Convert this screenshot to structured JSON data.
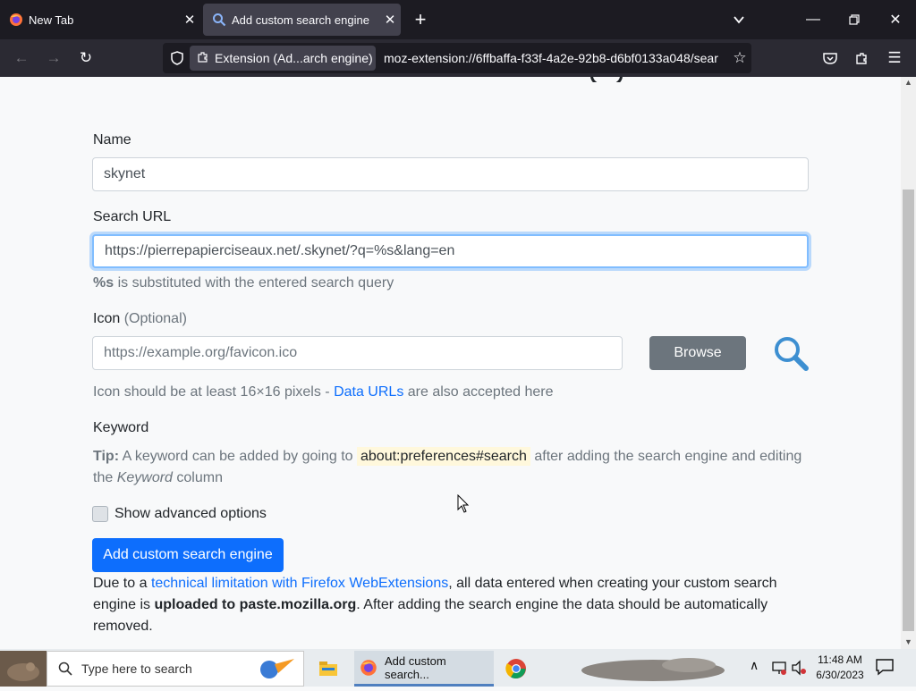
{
  "browser": {
    "tabs": [
      {
        "label": "New Tab",
        "icon": "firefox-icon"
      },
      {
        "label": "Add custom search engine",
        "icon": "search-icon",
        "active": true
      }
    ],
    "ext_badge": "Extension (Ad...arch engine)",
    "url": "moz-extension://6ffbaffa-f33f-4a2e-92b8-d6bf0133a048/sear"
  },
  "form": {
    "name_label": "Name",
    "name_value": "skynet",
    "search_url_label": "Search URL",
    "search_url_value": "https://pierrepapierciseaux.net/.skynet/?q=%s&lang=en",
    "search_url_hint_code": "%s",
    "search_url_hint_rest": " is substituted with the entered search query",
    "icon_label": "Icon",
    "icon_optional": "(Optional)",
    "icon_placeholder": "https://example.org/favicon.ico",
    "browse_label": "Browse",
    "icon_hint_pre": "Icon should be at least 16×16 pixels - ",
    "icon_hint_link": "Data URLs",
    "icon_hint_post": " are also accepted here",
    "keyword_label": "Keyword",
    "tip_bold": "Tip:",
    "tip_pre": " A keyword can be added by going to ",
    "tip_code": "about:preferences#search",
    "tip_post": " after adding the search engine and editing",
    "tip_line2_pre": "the ",
    "tip_line2_em": "Keyword",
    "tip_line2_post": " column",
    "advanced_label": "Show advanced options",
    "add_button": "Add custom search engine",
    "note_pre": "Due to a ",
    "note_link": "technical limitation with Firefox WebExtensions",
    "note_mid": ", all data entered when creating your custom search",
    "note_line2_pre": "engine is ",
    "note_line2_bold": "uploaded to paste.mozilla.org",
    "note_line2_post": ". After adding the search engine the data should be automatically",
    "note_line3": "removed."
  },
  "taskbar": {
    "search_placeholder": "Type here to search",
    "active_task": "Add custom search...",
    "time": "11:48 AM",
    "date": "6/30/2023"
  },
  "colors": {
    "accent": "#0d6efd",
    "search_icon": "#3d8fd1"
  }
}
